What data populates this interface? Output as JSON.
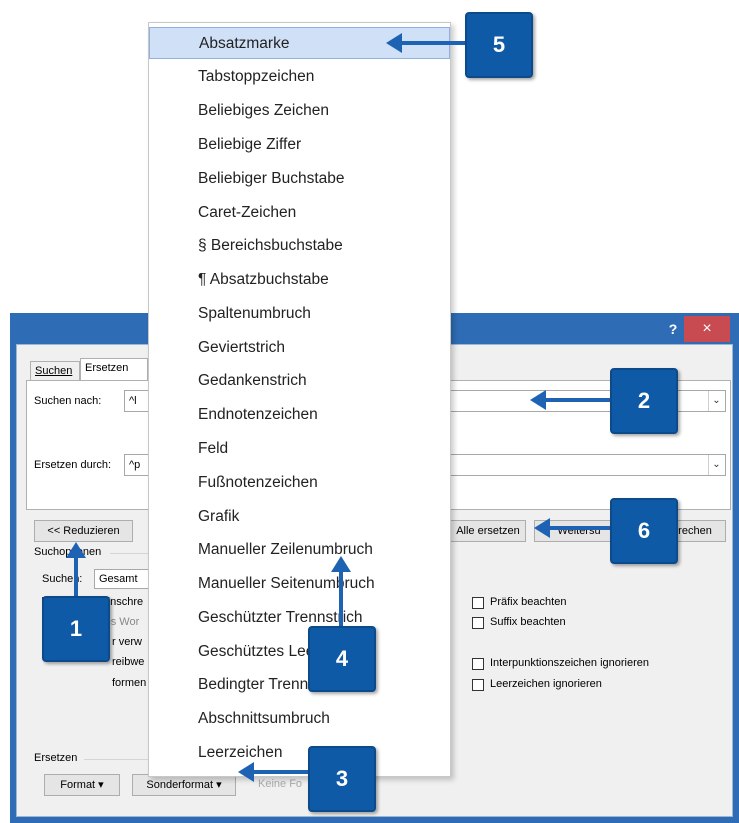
{
  "titlebar": {
    "help": "?",
    "close": "×"
  },
  "tabs": [
    {
      "label": "Suchen"
    },
    {
      "label": "Ersetzen"
    }
  ],
  "search": {
    "label": "Suchen nach:",
    "value": "^l"
  },
  "replace": {
    "label": "Ersetzen durch:",
    "value": "^p"
  },
  "buttons": {
    "reduce": "<< Reduzieren",
    "replace_all": "Alle ersetzen",
    "next_partial": "Weitersu",
    "cancel_partial": "rechen",
    "format": "Format ▾",
    "special": "Sonderformat ▾",
    "no_format_partial": "Keine Fo"
  },
  "options": {
    "group_label": "Suchoptionen",
    "search_label": "Suchen:",
    "search_value": "Gesamt",
    "left_checks": [
      "Groß-/Kleinschre",
      "Nur ganzes Wor",
      "r verw",
      "reibwe",
      "formen"
    ],
    "right_checks": [
      "Präfix beachten",
      "Suffix beachten",
      "Interpunktionszeichen ignorieren",
      "Leerzeichen ignorieren"
    ]
  },
  "replace_section": {
    "label": "Ersetzen"
  },
  "menu_items": [
    "Absatzmarke",
    "Tabstoppzeichen",
    "Beliebiges Zeichen",
    "Beliebige Ziffer",
    "Beliebiger Buchstabe",
    "Caret-Zeichen",
    "§ Bereichsbuchstabe",
    "¶ Absatzbuchstabe",
    "Spaltenumbruch",
    "Geviertstrich",
    "Gedankenstrich",
    "Endnotenzeichen",
    "Feld",
    "Fußnotenzeichen",
    "Grafik",
    "Manueller Zeilenumbruch",
    "Manueller Seitenumbruch",
    "Geschützter Trennstrich",
    "Geschütztes Leerzeichen",
    "Bedingter Trennstrich",
    "Abschnittsumbruch",
    "Leerzeichen"
  ],
  "callouts": [
    "1",
    "2",
    "3",
    "4",
    "5",
    "6"
  ],
  "colors": {
    "accent": "#0f5aa6",
    "titlebar": "#2e6db5",
    "close": "#c74b50",
    "highlight": "#cfe0f7"
  }
}
